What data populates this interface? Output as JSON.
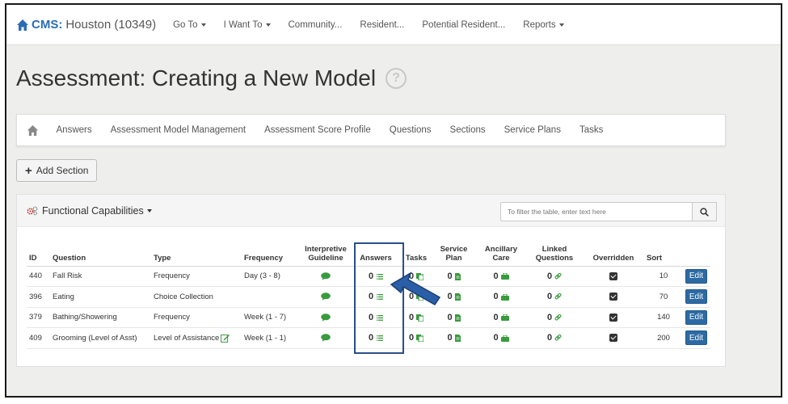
{
  "navbar": {
    "brand_prefix": "CMS:",
    "brand_name": "Houston (10349)",
    "items": [
      "Go To",
      "I Want To",
      "Community...",
      "Resident...",
      "Potential Resident...",
      "Reports"
    ]
  },
  "page": {
    "title": "Assessment: Creating a New Model",
    "help_symbol": "?"
  },
  "subnav": {
    "items": [
      "Answers",
      "Assessment Model Management",
      "Assessment Score Profile",
      "Questions",
      "Sections",
      "Service Plans",
      "Tasks"
    ]
  },
  "add_section": {
    "plus": "+",
    "label": "Add Section"
  },
  "panel": {
    "title": "Functional Capabilities",
    "filter_placeholder": "To filter the table, enter text here"
  },
  "table": {
    "headers": {
      "id": "ID",
      "question": "Question",
      "type": "Type",
      "frequency": "Frequency",
      "guideline_1": "Interpretive",
      "guideline_2": "Guideline",
      "answers": "Answers",
      "tasks": "Tasks",
      "service_1": "Service",
      "service_2": "Plan",
      "ancillary_1": "Ancillary",
      "ancillary_2": "Care",
      "linked_1": "Linked",
      "linked_2": "Questions",
      "overridden": "Overridden",
      "sort": "Sort"
    },
    "rows": [
      {
        "id": "440",
        "question": "Fall Risk",
        "type": "Frequency",
        "frequency": "Day (3 - 8)",
        "answers": "0",
        "tasks": "0",
        "service": "0",
        "ancillary": "0",
        "linked": "0",
        "sort": "10",
        "edit": "Edit"
      },
      {
        "id": "396",
        "question": "Eating",
        "type": "Choice Collection",
        "frequency": "",
        "answers": "0",
        "tasks": "0",
        "service": "0",
        "ancillary": "0",
        "linked": "0",
        "sort": "70",
        "edit": "Edit"
      },
      {
        "id": "379",
        "question": "Bathing/Showering",
        "type": "Frequency",
        "frequency": "Week (1 - 7)",
        "answers": "0",
        "tasks": "0",
        "service": "0",
        "ancillary": "0",
        "linked": "0",
        "sort": "140",
        "edit": "Edit"
      },
      {
        "id": "409",
        "question": "Grooming (Level of Asst)",
        "type": "Level of Assistance",
        "frequency": "Week (1 - 1)",
        "answers": "0",
        "tasks": "0",
        "service": "0",
        "ancillary": "0",
        "linked": "0",
        "sort": "200",
        "edit": "Edit"
      }
    ]
  },
  "colors": {
    "brand_blue": "#2a6db5",
    "edit_button": "#2d6aa3",
    "icon_green": "#3a9a3e",
    "annotation_blue": "#2a5fa8"
  },
  "icons": [
    "home-icon",
    "help-icon",
    "gears-icon",
    "search-icon",
    "comment-icon",
    "list-icon",
    "copy-icon",
    "file-icon",
    "briefcase-icon",
    "link-icon",
    "checkbox-icon",
    "edit-pencil-icon",
    "arrow-annotation"
  ]
}
